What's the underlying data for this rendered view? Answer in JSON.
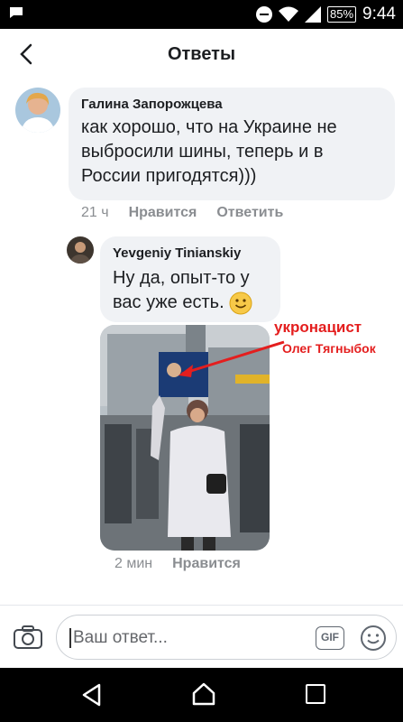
{
  "status_bar": {
    "battery": "85%",
    "time": "9:44",
    "icons": [
      "message-icon",
      "do-not-disturb-icon",
      "wifi-icon",
      "signal-icon",
      "battery-icon"
    ]
  },
  "header": {
    "title": "Ответы",
    "back_icon": "chevron-left-icon"
  },
  "comments": [
    {
      "author": "Галина Запорожцева",
      "text": "как хорошо, что на Украине не выбросили шины, теперь и в России пригодятся)))",
      "time": "21 ч",
      "like_label": "Нравится",
      "reply_label": "Ответить"
    },
    {
      "author": "Yevgeniy Tinianskiy",
      "text": "Ну да, опыт-то у вас уже есть.",
      "emoji": "🙂",
      "time": "2 мин",
      "like_label": "Нравится"
    }
  ],
  "photo_annotation": {
    "line1": "укронацист",
    "line2": "Олег Тягныбок",
    "color": "#e41e1e"
  },
  "composer": {
    "placeholder": "Ваш ответ...",
    "gif_label": "GIF",
    "icons": [
      "camera-icon",
      "gif-icon",
      "emoji-icon"
    ]
  },
  "nav_bar": {
    "icons": [
      "back-triangle-icon",
      "home-icon",
      "recent-apps-icon"
    ]
  }
}
